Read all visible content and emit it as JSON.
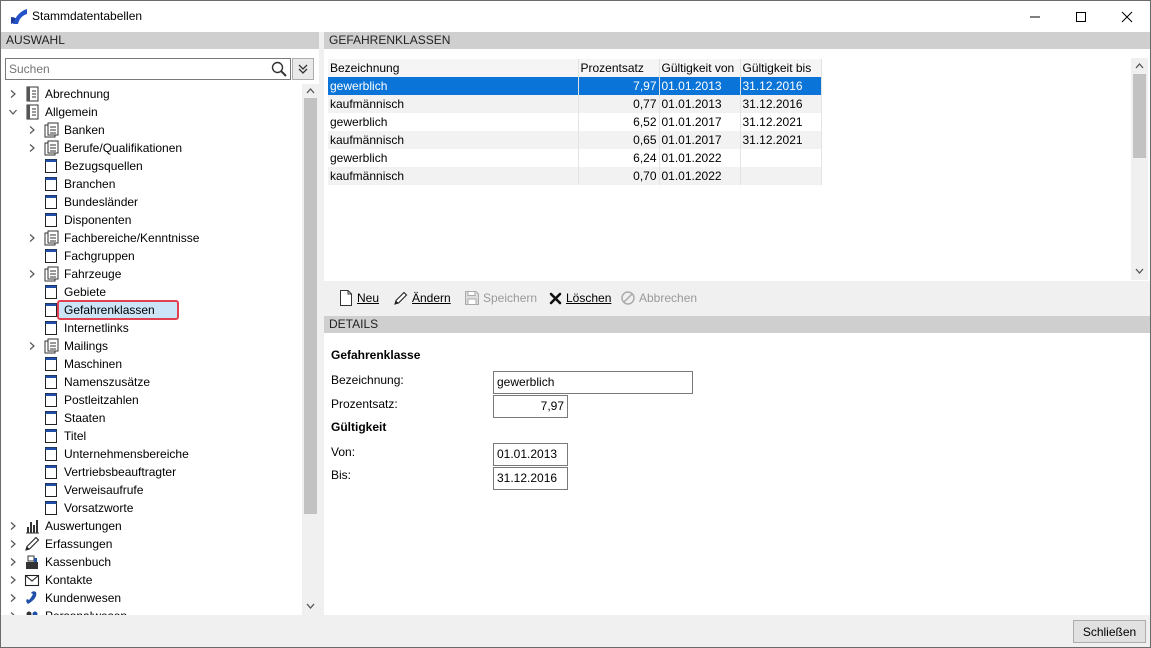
{
  "window": {
    "title": "Stammdatentabellen",
    "close_label": "Schließen"
  },
  "left": {
    "header": "AUSWAHL",
    "search_placeholder": "Suchen",
    "tree": [
      {
        "label": "Abrechnung",
        "level": 0,
        "expandable": true,
        "icon": "ledger-icon"
      },
      {
        "label": "Allgemein",
        "level": 0,
        "expandable": true,
        "expanded": true,
        "icon": "ledger-icon"
      },
      {
        "label": "Banken",
        "level": 1,
        "expandable": true,
        "icon": "document-stack-icon"
      },
      {
        "label": "Berufe/Qualifikationen",
        "level": 1,
        "expandable": true,
        "icon": "document-stack-icon"
      },
      {
        "label": "Bezugsquellen",
        "level": 1,
        "expandable": false,
        "icon": "table-icon"
      },
      {
        "label": "Branchen",
        "level": 1,
        "expandable": false,
        "icon": "table-icon"
      },
      {
        "label": "Bundesländer",
        "level": 1,
        "expandable": false,
        "icon": "table-icon"
      },
      {
        "label": "Disponenten",
        "level": 1,
        "expandable": false,
        "icon": "table-icon"
      },
      {
        "label": "Fachbereiche/Kenntnisse",
        "level": 1,
        "expandable": true,
        "icon": "document-stack-icon"
      },
      {
        "label": "Fachgruppen",
        "level": 1,
        "expandable": false,
        "icon": "table-icon"
      },
      {
        "label": "Fahrzeuge",
        "level": 1,
        "expandable": true,
        "icon": "document-stack-icon"
      },
      {
        "label": "Gebiete",
        "level": 1,
        "expandable": false,
        "icon": "table-icon"
      },
      {
        "label": "Gefahrenklassen",
        "level": 1,
        "expandable": false,
        "icon": "table-icon",
        "selected": true
      },
      {
        "label": "Internetlinks",
        "level": 1,
        "expandable": false,
        "icon": "table-icon"
      },
      {
        "label": "Mailings",
        "level": 1,
        "expandable": true,
        "icon": "document-stack-icon"
      },
      {
        "label": "Maschinen",
        "level": 1,
        "expandable": false,
        "icon": "table-icon"
      },
      {
        "label": "Namenszusätze",
        "level": 1,
        "expandable": false,
        "icon": "table-icon"
      },
      {
        "label": "Postleitzahlen",
        "level": 1,
        "expandable": false,
        "icon": "table-icon"
      },
      {
        "label": "Staaten",
        "level": 1,
        "expandable": false,
        "icon": "table-icon"
      },
      {
        "label": "Titel",
        "level": 1,
        "expandable": false,
        "icon": "table-icon"
      },
      {
        "label": "Unternehmensbereiche",
        "level": 1,
        "expandable": false,
        "icon": "table-icon"
      },
      {
        "label": "Vertriebsbeauftragter",
        "level": 1,
        "expandable": false,
        "icon": "table-icon"
      },
      {
        "label": "Verweisaufrufe",
        "level": 1,
        "expandable": false,
        "icon": "table-icon"
      },
      {
        "label": "Vorsatzworte",
        "level": 1,
        "expandable": false,
        "icon": "table-icon"
      },
      {
        "label": "Auswertungen",
        "level": 0,
        "expandable": true,
        "icon": "bar-chart-icon"
      },
      {
        "label": "Erfassungen",
        "level": 0,
        "expandable": true,
        "icon": "pencil-icon"
      },
      {
        "label": "Kassenbuch",
        "level": 0,
        "expandable": true,
        "icon": "cash-register-icon"
      },
      {
        "label": "Kontakte",
        "level": 0,
        "expandable": true,
        "icon": "envelope-icon"
      },
      {
        "label": "Kundenwesen",
        "level": 0,
        "expandable": true,
        "icon": "phone-icon"
      },
      {
        "label": "Personalwesen",
        "level": 0,
        "expandable": true,
        "icon": "people-icon"
      }
    ]
  },
  "right": {
    "header": "GEFAHRENKLASSEN",
    "columns": [
      "Bezeichnung",
      "Prozentsatz",
      "Gültigkeit von",
      "Gültigkeit bis"
    ],
    "rows": [
      {
        "bezeichnung": "gewerblich",
        "prozentsatz": "7,97",
        "von": "01.01.2013",
        "bis": "31.12.2016",
        "selected": true
      },
      {
        "bezeichnung": "kaufmännisch",
        "prozentsatz": "0,77",
        "von": "01.01.2013",
        "bis": "31.12.2016"
      },
      {
        "bezeichnung": "gewerblich",
        "prozentsatz": "6,52",
        "von": "01.01.2017",
        "bis": "31.12.2021"
      },
      {
        "bezeichnung": "kaufmännisch",
        "prozentsatz": "0,65",
        "von": "01.01.2017",
        "bis": "31.12.2021"
      },
      {
        "bezeichnung": "gewerblich",
        "prozentsatz": "6,24",
        "von": "01.01.2022",
        "bis": ""
      },
      {
        "bezeichnung": "kaufmännisch",
        "prozentsatz": "0,70",
        "von": "01.01.2022",
        "bis": ""
      }
    ],
    "toolbar": {
      "new_label": "Neu",
      "edit_label": "Ändern",
      "save_label": "Speichern",
      "delete_label": "Löschen",
      "cancel_label": "Abbrechen"
    },
    "details": {
      "header": "DETAILS",
      "group_title": "Gefahrenklasse",
      "bezeichnung_label": "Bezeichnung:",
      "bezeichnung_value": "gewerblich",
      "prozentsatz_label": "Prozentsatz:",
      "prozentsatz_value": "7,97",
      "validity_title": "Gültigkeit",
      "von_label": "Von:",
      "von_value": "01.01.2013",
      "bis_label": "Bis:",
      "bis_value": "31.12.2016"
    }
  },
  "colors": {
    "selection": "#0a74d8",
    "header_bg": "#cfcfcf",
    "highlight_border": "#e04050"
  }
}
